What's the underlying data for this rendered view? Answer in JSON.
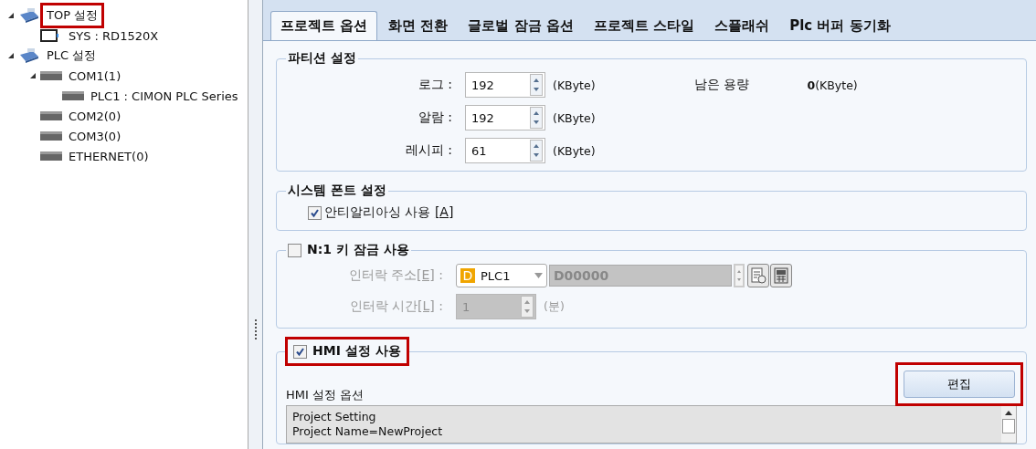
{
  "tree": [
    {
      "label": "TOP 설정",
      "kind": "hmi",
      "expanded": true,
      "highlighted": true,
      "children": [
        {
          "label": "SYS : RD1520X",
          "kind": "screen"
        }
      ]
    },
    {
      "label": "PLC 설정",
      "kind": "hmi",
      "expanded": true,
      "highlighted": false,
      "children": [
        {
          "label": "COM1(1)",
          "kind": "device",
          "expanded": true,
          "highlighted": false,
          "children": [
            {
              "label": "PLC1 : CIMON PLC Series",
              "kind": "device"
            }
          ]
        },
        {
          "label": "COM2(0)",
          "kind": "device"
        },
        {
          "label": "COM3(0)",
          "kind": "device"
        },
        {
          "label": "ETHERNET(0)",
          "kind": "device"
        }
      ]
    }
  ],
  "tabs": [
    {
      "label": "프로젝트 옵션",
      "selected": true
    },
    {
      "label": "화면 전환",
      "selected": false
    },
    {
      "label": "글로벌 잠금 옵션",
      "selected": false
    },
    {
      "label": "프로젝트 스타일",
      "selected": false
    },
    {
      "label": "스플래쉬",
      "selected": false
    },
    {
      "label": "Plc 버퍼 동기화",
      "selected": false
    }
  ],
  "partition": {
    "title": "파티션 설정",
    "rows": [
      {
        "label": "로그 :",
        "value": "192",
        "unit": "(KByte)"
      },
      {
        "label": "알람 :",
        "value": "192",
        "unit": "(KByte)"
      },
      {
        "label": "레시피 :",
        "value": "61",
        "unit": "(KByte)"
      }
    ],
    "remaining_label": "남은 용량",
    "remaining_value": "0",
    "remaining_unit": "(KByte)"
  },
  "font": {
    "title": "시스템 폰트 설정",
    "antialias": {
      "label": "안티알리아싱 사용",
      "shortcut": "[A]",
      "checked": true
    }
  },
  "keylock": {
    "title": "N:1 키 잠금 사용",
    "checked": false,
    "address_label": "인터락 주소",
    "address_shortcut": "[E]",
    "colon": ":",
    "device_badge": "D",
    "device": "PLC1",
    "address": "D00000",
    "time_label": "인터락 시간",
    "time_shortcut": "[L]",
    "time_value": "1",
    "time_unit": "(분)"
  },
  "hmi": {
    "title": "HMI 설정 사용",
    "checked": true,
    "highlighted": true,
    "options_label": "HMI 설정 옵션",
    "edit_button": {
      "label": "편집",
      "highlighted": true
    },
    "text_lines": [
      "Project Setting",
      "Project Name=NewProject"
    ]
  }
}
